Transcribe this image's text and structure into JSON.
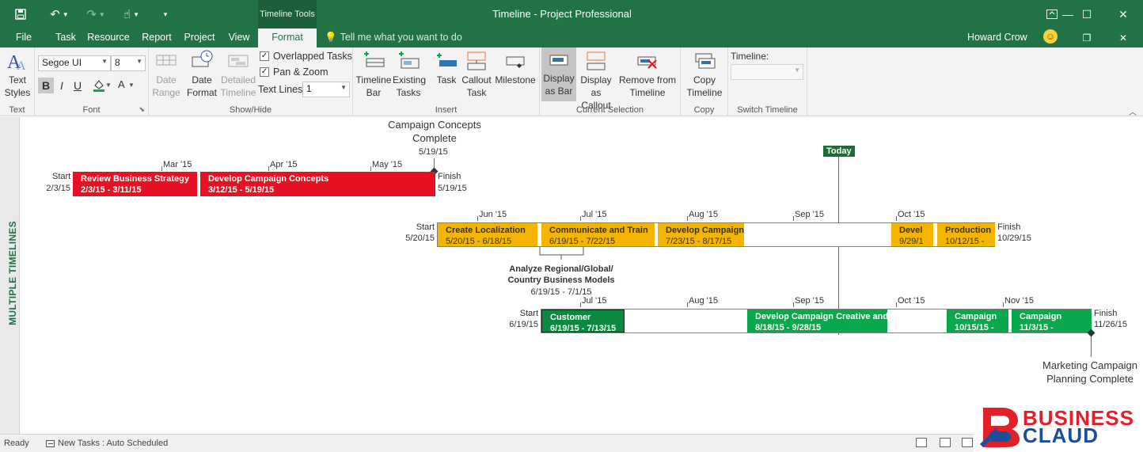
{
  "app": {
    "window_title": "Timeline - Project Professional",
    "context_tab_group": "Timeline Tools",
    "user_name": "Howard Crow"
  },
  "tabs": [
    {
      "label": "File"
    },
    {
      "label": "Task"
    },
    {
      "label": "Resource"
    },
    {
      "label": "Report"
    },
    {
      "label": "Project"
    },
    {
      "label": "View"
    },
    {
      "label": "Format"
    }
  ],
  "active_tab": "Format",
  "tell_me": {
    "placeholder": "Tell me what you want to do"
  },
  "ribbon": {
    "text_group": {
      "label": "Text",
      "text_styles": "Text Styles"
    },
    "font_group": {
      "label": "Font",
      "font_name": "Segoe UI",
      "font_size": "8",
      "bold": "B",
      "italic": "I",
      "underline": "U"
    },
    "showhide_group": {
      "label": "Show/Hide",
      "date_range": "Date Range",
      "date_format": "Date Format",
      "detailed_timeline": "Detailed Timeline",
      "overlapped_tasks": "Overlapped Tasks",
      "overlapped_checked": true,
      "pan_zoom": "Pan & Zoom",
      "pan_zoom_checked": true,
      "text_lines_label": "Text Lines:",
      "text_lines_value": "1"
    },
    "insert_group": {
      "label": "Insert",
      "timeline_bar": "Timeline Bar",
      "existing_tasks": "Existing Tasks",
      "task": "Task",
      "callout_task": "Callout Task",
      "milestone": "Milestone"
    },
    "current_selection_group": {
      "label": "Current Selection",
      "display_as_bar": "Display as Bar",
      "display_as_callout": "Display as Callout",
      "remove_from_timeline": "Remove from Timeline"
    },
    "copy_group": {
      "label": "Copy",
      "copy_timeline": "Copy Timeline"
    },
    "switch_timeline_group": {
      "label": "Switch Timeline",
      "timeline_label": "Timeline:",
      "timeline_value": ""
    }
  },
  "sidebar": {
    "label": "MULTIPLE TIMELINES"
  },
  "timelines": [
    {
      "start_label": "Start",
      "start_date": "2/3/15",
      "finish_label": "Finish",
      "finish_date": "5/19/15",
      "ticks": [
        "Mar '15",
        "Apr '15",
        "May '15"
      ],
      "tasks": [
        {
          "name": "Review Business Strategy",
          "dates": "2/3/15 - 3/11/15",
          "color": "#e81123"
        },
        {
          "name": "Develop Campaign Concepts",
          "dates": "3/12/15 - 5/19/15",
          "color": "#e81123"
        }
      ],
      "milestone": {
        "line1": "Campaign Concepts",
        "line2": "Complete",
        "date": "5/19/15"
      }
    },
    {
      "start_label": "Start",
      "start_date": "5/20/15",
      "finish_label": "Finish",
      "finish_date": "10/29/15",
      "ticks": [
        "Jun '15",
        "Jul '15",
        "Aug '15",
        "Sep '15",
        "Oct '15"
      ],
      "tasks": [
        {
          "name": "Create Localization",
          "dates": "5/20/15 - 6/18/15",
          "color": "#f5b400"
        },
        {
          "name": "Communicate and Train",
          "dates": "6/19/15 - 7/22/15",
          "color": "#f5b400"
        },
        {
          "name": "Develop Campaign",
          "dates": "7/23/15 - 8/17/15",
          "color": "#f5b400"
        },
        {
          "name": "Devel",
          "dates": "9/29/1",
          "color": "#f5b400"
        },
        {
          "name": "Production",
          "dates": "10/12/15 -",
          "color": "#f5b400"
        }
      ],
      "callout": {
        "line1": "Analyze Regional/Global/",
        "line2": "Country Business Models",
        "dates": "6/19/15 - 7/1/15"
      }
    },
    {
      "start_label": "Start",
      "start_date": "6/19/15",
      "finish_label": "Finish",
      "finish_date": "11/26/15",
      "ticks": [
        "Jul '15",
        "Aug '15",
        "Sep '15",
        "Oct '15",
        "Nov '15"
      ],
      "tasks": [
        {
          "name": "Customer",
          "dates": "6/19/15 - 7/13/15",
          "color": "#0a8a3f"
        },
        {
          "name": "Develop Campaign Creative and",
          "dates": "8/18/15 - 9/28/15",
          "color": "#09a84b"
        },
        {
          "name": "Campaign",
          "dates": "10/15/15 -",
          "color": "#09a84b"
        },
        {
          "name": "Campaign",
          "dates": "11/3/15 -",
          "color": "#09a84b"
        }
      ],
      "milestone": {
        "line1": "Marketing Campaign",
        "line2": "Planning Complete"
      }
    }
  ],
  "today_label": "Today",
  "status_bar": {
    "ready": "Ready",
    "new_tasks": "New Tasks : Auto Scheduled"
  },
  "logo": {
    "word1": "BUSINESS",
    "word2": "CLAUD"
  },
  "colors": {
    "brand_green": "#217346",
    "red": "#e81123",
    "orange": "#f5b400",
    "green": "#09a84b"
  }
}
